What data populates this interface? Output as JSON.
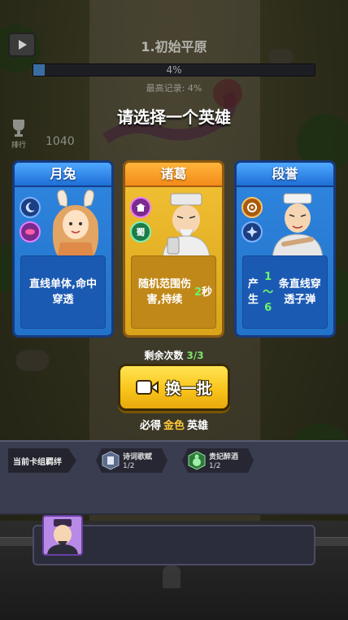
{
  "hud": {
    "level_title": "1.初始平原",
    "progress_text": "4%",
    "progress_value": 0.04,
    "record_text": "最高记录: 4%",
    "rank_label": "排行",
    "score": "1040"
  },
  "selection": {
    "title": "请选择一个英雄",
    "cards": [
      {
        "name": "月兔",
        "rarity": "blue",
        "desc": "直线单体,命中穿透"
      },
      {
        "name": "诸葛",
        "rarity": "gold",
        "badge_text": "蜀",
        "desc": "随机范围伤害,持续2秒",
        "desc_pre": "随机范围伤害,持续",
        "desc_num": "2",
        "desc_post": "秒"
      },
      {
        "name": "段誉",
        "rarity": "blue",
        "desc": "产生1～6条直线穿透子弹",
        "desc_pre": "产生",
        "desc_num": "1～6",
        "desc_post": "条直线穿透子弹"
      }
    ],
    "remaining_label": "剩余次数",
    "remaining_count": "3/3",
    "refresh_label": "换一批",
    "guarantee_pre": "必得",
    "guarantee_gold": "金色",
    "guarantee_post": "英雄"
  },
  "bonds": {
    "label": "当前卡组羁绊",
    "items": [
      {
        "name": "诗词歌赋",
        "progress": "1/2"
      },
      {
        "name": "贵妃醉酒",
        "progress": "1/2"
      }
    ]
  },
  "colors": {
    "blue_card": "#2f86df",
    "gold_card": "#f3c235",
    "highlight_green": "#6ff56a",
    "button_yellow": "#f9c51b"
  }
}
